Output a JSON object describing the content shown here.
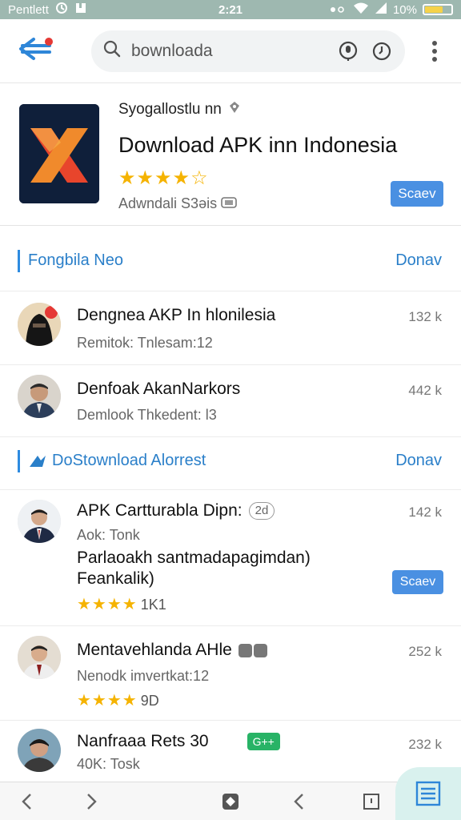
{
  "status_bar": {
    "carrier": "Pentlett",
    "time": "2:21",
    "battery": "10%"
  },
  "search": {
    "value": "bownloada"
  },
  "hero": {
    "developer": "Syogallostlu nn",
    "title": "Download APK inn Indonesia",
    "rating_stars": "★★★★☆",
    "meta": "Adwndali S3əis",
    "install_label": "Scaev"
  },
  "section1": {
    "title": "Fongbila Neo",
    "more": "Donav"
  },
  "section1_items": [
    {
      "name": "Dengnea AKP In hlonilesia",
      "sub": "Remitok: Tnlesam:12",
      "count": "132 k"
    },
    {
      "name": "Denfoak AkanNarkors",
      "sub": "Demlook Thkedent: l3",
      "count": "442 k"
    }
  ],
  "section2": {
    "title": "DoStownload Alorrest",
    "more": "Donav"
  },
  "section2_items": [
    {
      "name": "APK Cartturabla Dipn:",
      "chip": "2d",
      "sub": "Aok: Tonk",
      "desc": "Parlaoakh santmadapagimdan) Feankalik)",
      "stars": "★★★★",
      "rating_count": "1K1",
      "count": "142 k",
      "install_label": "Scaev"
    },
    {
      "name": "Mentavehlanda AHle",
      "sub": "Nenodk imvertkat:12",
      "stars": "★★★★",
      "rating_count": "9D",
      "count": "252 k"
    },
    {
      "name": "Nanfraaa Rets 30",
      "badge": "G++",
      "sub": "40K: Tosk",
      "count": "232 k"
    }
  ],
  "colors": {
    "accent": "#4a90e2",
    "status_bar": "#9eb8b0",
    "star": "#f5b301",
    "fab": "#d9f1ee"
  }
}
